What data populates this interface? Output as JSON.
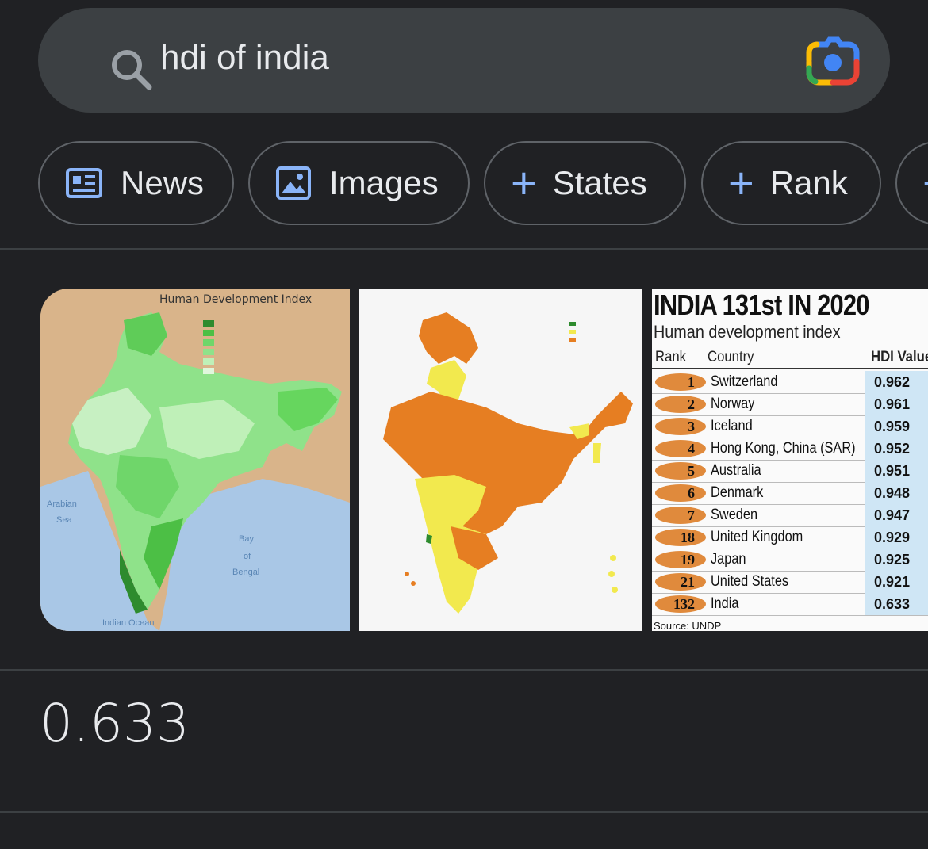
{
  "search": {
    "query": "hdi of india"
  },
  "chips": [
    {
      "label": "News",
      "icon": "news-icon"
    },
    {
      "label": "Images",
      "icon": "image-icon"
    },
    {
      "label": "States",
      "icon": "plus-icon"
    },
    {
      "label": "Rank",
      "icon": "plus-icon"
    }
  ],
  "images": {
    "map1": {
      "title": "Human Development Index",
      "sea_labels": [
        "Arabian",
        "Sea",
        "Bay",
        "of",
        "Bengal",
        "Indian Ocean"
      ]
    },
    "table": {
      "title": "INDIA 131st IN 2020",
      "subtitle": "Human development index",
      "headers": [
        "Rank",
        "Country",
        "HDI Value"
      ],
      "rows": [
        {
          "rank": "1",
          "country": "Switzerland",
          "value": "0.962"
        },
        {
          "rank": "2",
          "country": "Norway",
          "value": "0.961"
        },
        {
          "rank": "3",
          "country": "Iceland",
          "value": "0.959"
        },
        {
          "rank": "4",
          "country": "Hong Kong, China (SAR)",
          "value": "0.952"
        },
        {
          "rank": "5",
          "country": "Australia",
          "value": "0.951"
        },
        {
          "rank": "6",
          "country": "Denmark",
          "value": "0.948"
        },
        {
          "rank": "7",
          "country": "Sweden",
          "value": "0.947"
        },
        {
          "rank": "18",
          "country": "United Kingdom",
          "value": "0.929"
        },
        {
          "rank": "19",
          "country": "Japan",
          "value": "0.925"
        },
        {
          "rank": "21",
          "country": "United States",
          "value": "0.921"
        },
        {
          "rank": "132",
          "country": "India",
          "value": "0.633"
        }
      ],
      "source": "Source: UNDP"
    }
  },
  "answer": {
    "value": "0.633"
  },
  "colors": {
    "background": "#202124",
    "search_bar": "#3c4043",
    "accent_blue": "#8ab4f8",
    "map_green": "#4caf50",
    "map_orange": "#e67e22",
    "map_yellow": "#f0e442"
  }
}
